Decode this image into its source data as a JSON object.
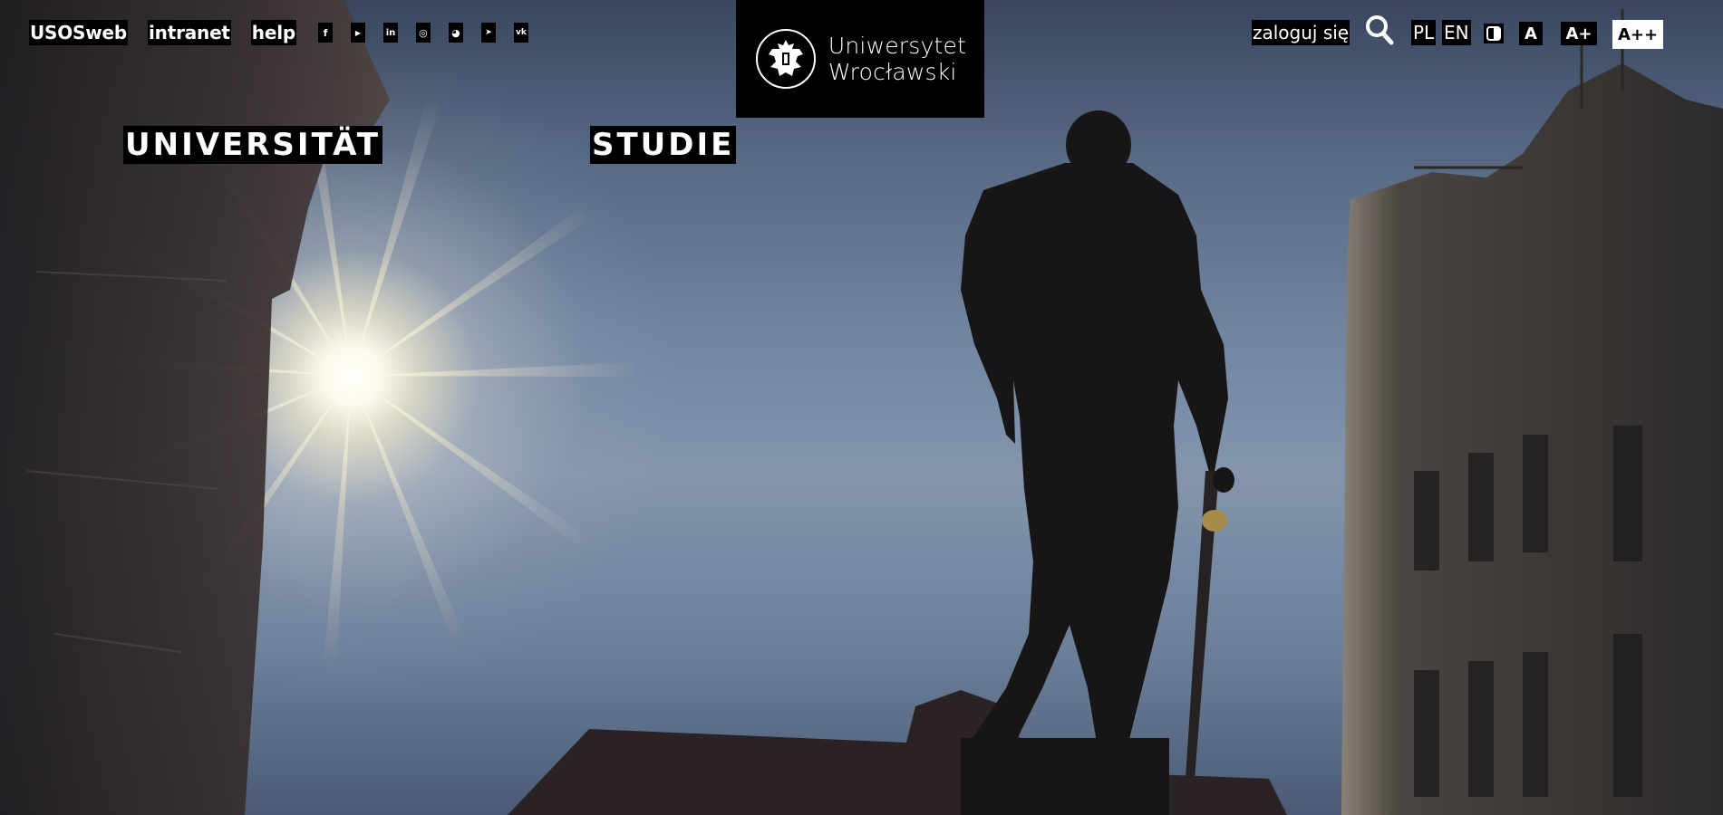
{
  "topbar": {
    "links": [
      {
        "label": "USOSweb"
      },
      {
        "label": "intranet"
      },
      {
        "label": "help"
      }
    ],
    "social_icons": [
      {
        "icon": "facebook-icon",
        "glyph": "f"
      },
      {
        "icon": "youtube-icon",
        "glyph": "▶"
      },
      {
        "icon": "linkedin-icon",
        "glyph": "in"
      },
      {
        "icon": "instagram-icon",
        "glyph": "◎"
      },
      {
        "icon": "snapchat-icon",
        "glyph": "◕"
      },
      {
        "icon": "telegram-icon",
        "glyph": "➤"
      },
      {
        "icon": "vk-icon",
        "glyph": "vk"
      }
    ]
  },
  "logo": {
    "line1": "Uniwersytet",
    "line2": "Wrocławski",
    "emblem_icon": "university-eagle-emblem-icon"
  },
  "account": {
    "login_label": "zaloguj się",
    "search_icon": "search-icon"
  },
  "languages": [
    {
      "code": "PL"
    },
    {
      "code": "EN"
    }
  ],
  "accessibility": {
    "contrast_icon": "contrast-icon",
    "font_small": "A",
    "font_medium": "A+",
    "font_large": "A++"
  },
  "main_nav": [
    {
      "label": "UNIVERSITÄT"
    },
    {
      "label": "STUDIE"
    }
  ],
  "colors": {
    "label_background": "#000000",
    "label_text": "#ffffff",
    "sky": "#6f849f"
  }
}
